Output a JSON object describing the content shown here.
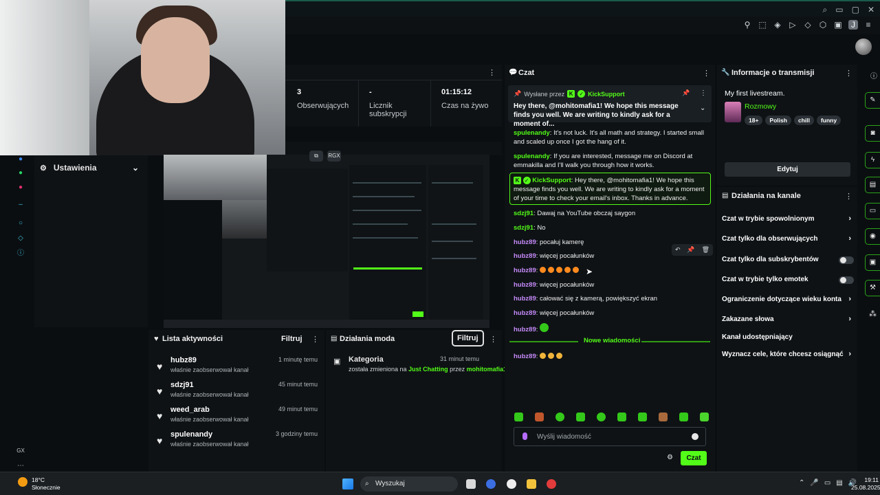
{
  "stream_stats": {
    "followers_value": "3",
    "followers_label": "Obserwujących",
    "subs_value": "-",
    "subs_label": "Licznik subskrypcji",
    "live_value": "01:15:12",
    "live_label": "Czas na żywo"
  },
  "settings": {
    "title": "Ustawienia"
  },
  "preview": {
    "btn_rgx": "RGX"
  },
  "activity": {
    "title": "Lista aktywności",
    "filter_label": "Filtruj",
    "items": [
      {
        "name": "hubz89",
        "sub": "właśnie zaobserwował kanał",
        "time": "1 minutę temu"
      },
      {
        "name": "sdzj91",
        "sub": "właśnie zaobserwował kanał",
        "time": "45 minut temu"
      },
      {
        "name": "weed_arab",
        "sub": "właśnie zaobserwował kanał",
        "time": "49 minut temu"
      },
      {
        "name": "spulenandy",
        "sub": "właśnie zaobserwował kanał",
        "time": "3 godziny temu"
      }
    ]
  },
  "mod": {
    "title": "Działania moda",
    "filter_label": "Filtruj",
    "item_title": "Kategoria",
    "item_time": "31 minut temu",
    "item_prefix": "została zmieniona na",
    "item_category": "Just Chatting",
    "item_by": "przez",
    "item_user": "mohitomafia1"
  },
  "chat": {
    "title": "Czat",
    "pinned_by": "Wysłane przez",
    "pinned_user": "KickSupport",
    "pinned_text": "Hey there, @mohitomafia1! We hope this message finds you well. We are writing to kindly ask for a moment of...",
    "messages": [
      {
        "user": "spulenandy",
        "text": "It's not luck. It's all math and strategy. I started small and scaled up once I got the hang of it."
      },
      {
        "user": "spulenandy",
        "text": "If you are interested, message me on Discord at emmakilla and I'll walk you through how it works."
      },
      {
        "user": "KickSupport",
        "text": "Hey there, @mohitomafia1! We hope this message finds you well. We are writing to kindly ask for a moment of your time to check your email's inbox. Thanks in advance."
      },
      {
        "user": "sdzj91",
        "text": "Dawaj na YouTube obczaj saygon"
      },
      {
        "user": "sdzj91",
        "text": "No"
      },
      {
        "user": "hubz89",
        "text": "pocałuj kamerę"
      },
      {
        "user": "hubz89",
        "text": "więcej pocałunków"
      },
      {
        "user": "hubz89",
        "text": ""
      },
      {
        "user": "hubz89",
        "text": "więcej pocałunków"
      },
      {
        "user": "hubz89",
        "text": "całować się z kamerą, powiększyć ekran"
      },
      {
        "user": "hubz89",
        "text": "więcej pocałunków"
      },
      {
        "user": "hubz89",
        "text": ""
      },
      {
        "user": "hubz89",
        "text": ""
      }
    ],
    "new_messages_label": "Nowe wiadomości",
    "input_placeholder": "Wyślij wiadomość",
    "send_label": "Czat"
  },
  "info": {
    "title": "Informacje o transmisji",
    "stream_title": "My first livestream.",
    "category": "Rozmowy",
    "tags": [
      "18+",
      "Polish",
      "chill",
      "funny"
    ],
    "edit_label": "Edytuj"
  },
  "channel_actions": {
    "title": "Działania na kanale",
    "rows": [
      {
        "label": "Czat w trybie spowolnionym",
        "kind": "arrow"
      },
      {
        "label": "Czat tylko dla obserwujących",
        "kind": "arrow"
      },
      {
        "label": "Czat tylko dla subskrybentów",
        "kind": "toggle"
      },
      {
        "label": "Czat w trybie tylko emotek",
        "kind": "toggle"
      },
      {
        "label": "Ograniczenie dotyczące wieku konta",
        "kind": "arrow"
      },
      {
        "label": "Zakazane słowa",
        "kind": "arrow"
      },
      {
        "label": "Kanał udostępniający",
        "kind": "none"
      },
      {
        "label": "Wyznacz cele, które chcesz osiągnąć",
        "kind": "arrow"
      }
    ]
  },
  "taskbar": {
    "temp": "18°C",
    "weather": "Słonecznie",
    "search_label": "Wyszukaj",
    "time": "19:11",
    "date": "25.08.2025"
  },
  "rail": {
    "gx_label": "GX"
  },
  "colors": {
    "kick_green": "#53fc18",
    "purple_user": "#c58af9",
    "panel_bg": "#0e1215"
  }
}
